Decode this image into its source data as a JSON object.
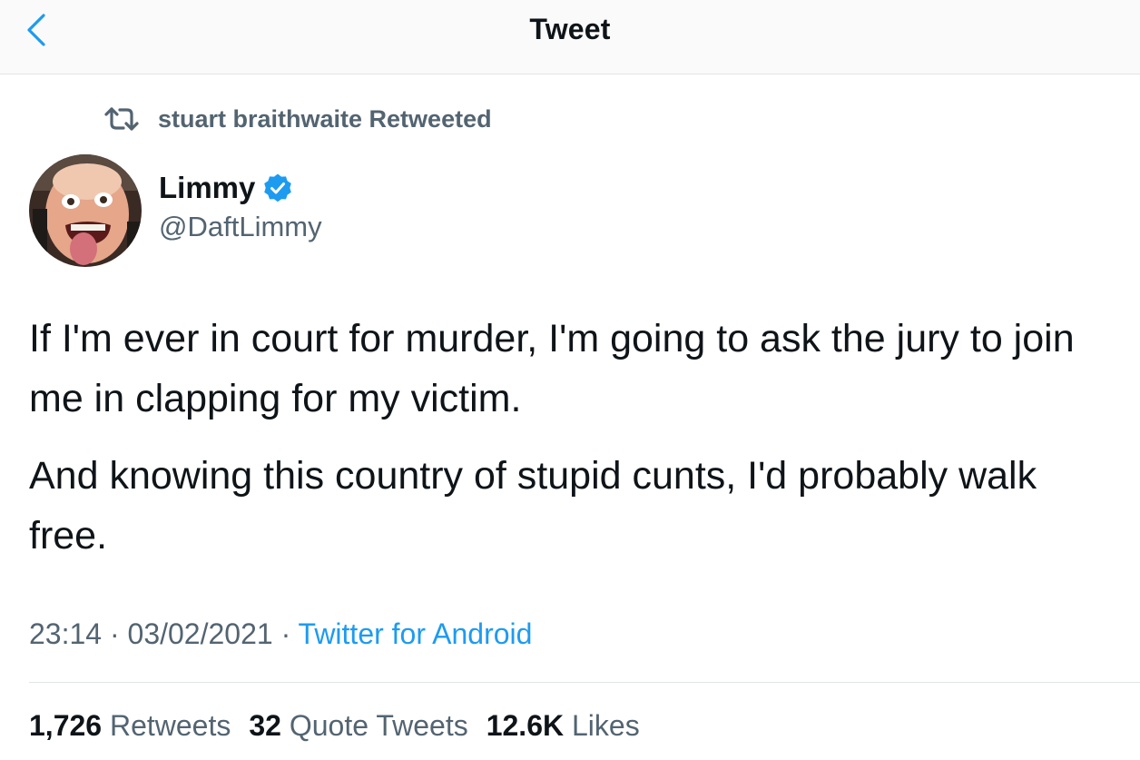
{
  "header": {
    "title": "Tweet",
    "back_icon": "chevron-left-icon"
  },
  "retweet_banner": {
    "icon": "retweet-icon",
    "text": "stuart braithwaite Retweeted"
  },
  "author": {
    "name": "Limmy",
    "handle": "@DaftLimmy",
    "verified_icon": "verified-badge-icon"
  },
  "tweet": {
    "paragraphs": [
      "If I'm ever in court for murder, I'm going to ask the jury to join me in clapping for my victim.",
      "And knowing this country of stupid cunts, I'd probably walk free."
    ]
  },
  "meta": {
    "time": "23:14",
    "date": "03/02/2021",
    "separator": "·",
    "source": "Twitter for Android"
  },
  "stats": {
    "retweets_count": "1,726",
    "retweets_label": "Retweets",
    "quotes_count": "32",
    "quotes_label": "Quote Tweets",
    "likes_count": "12.6K",
    "likes_label": "Likes"
  },
  "colors": {
    "accent": "#1d9bf0",
    "secondary_text": "#536471",
    "primary_text": "#0f1419",
    "divider": "#e1e5e8"
  }
}
